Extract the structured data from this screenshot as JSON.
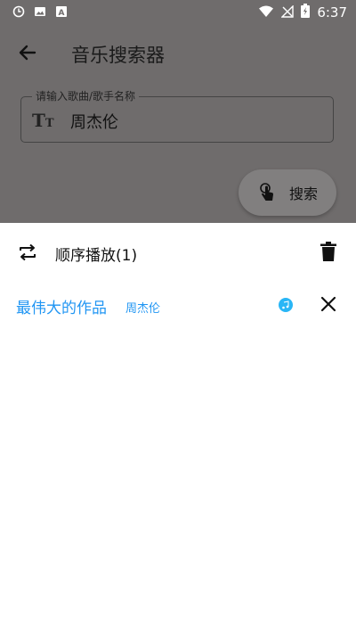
{
  "status_bar": {
    "time": "6:37",
    "icons": [
      "sync-icon",
      "image-icon",
      "a-icon",
      "wifi-icon",
      "no-signal-icon",
      "battery-charging-icon"
    ]
  },
  "app_bar": {
    "title": "音乐搜索器",
    "back_icon": "arrow-back-icon"
  },
  "search": {
    "label": "请输入歌曲/歌手名称",
    "value": "周杰伦",
    "prefix_icon": "text-size-icon",
    "button_label": "搜索",
    "button_icon": "touch-icon"
  },
  "playlist": {
    "mode_label": "顺序播放(1)",
    "mode_icon": "repeat-icon",
    "clear_icon": "trash-icon",
    "accent_color": "#2196f3",
    "items": [
      {
        "title": "最伟大的作品",
        "artist": "周杰伦",
        "playing": true
      }
    ]
  }
}
